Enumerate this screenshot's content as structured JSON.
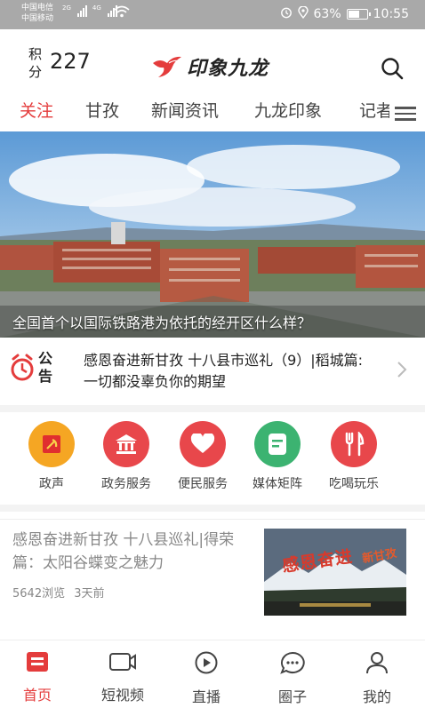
{
  "status_bar": {
    "carrier_1": "中国电信",
    "carrier_2": "中国移动",
    "net_1": "2G",
    "net_2": "4G",
    "battery_percent": "63%",
    "battery_level": 0.63,
    "time": "10:55"
  },
  "header": {
    "points_label": "积分",
    "points_value": "227",
    "brand_name": "印象九龙"
  },
  "tabs": [
    {
      "label": "关注",
      "active": true
    },
    {
      "label": "甘孜",
      "active": false
    },
    {
      "label": "新闻资讯",
      "active": false
    },
    {
      "label": "九龙印象",
      "active": false
    },
    {
      "label": "记者",
      "active": false
    }
  ],
  "banner": {
    "caption": "全国首个以国际铁路港为依托的经开区什么样？"
  },
  "notice": {
    "icon_text": "公告",
    "text": "感恩奋进新甘孜 十八县市巡礼（9）|稻城篇:一切都没辜负你的期望"
  },
  "quick_links": [
    {
      "label": "政声",
      "color": "#f5a623"
    },
    {
      "label": "政务服务",
      "color": "#e8474b"
    },
    {
      "label": "便民服务",
      "color": "#e8474b"
    },
    {
      "label": "媒体矩阵",
      "color": "#3cb371"
    },
    {
      "label": "吃喝玩乐",
      "color": "#e8474b"
    }
  ],
  "news": {
    "title": "感恩奋进新甘孜 十八县巡礼|得荣篇：太阳谷蝶变之魅力",
    "views": "5642浏览",
    "time": "3天前",
    "thumb_title": "感恩奋进",
    "thumb_side": "新甘孜"
  },
  "bottom_nav": [
    {
      "label": "首页",
      "active": true
    },
    {
      "label": "短视频",
      "active": false
    },
    {
      "label": "直播",
      "active": false
    },
    {
      "label": "圈子",
      "active": false
    },
    {
      "label": "我的",
      "active": false
    }
  ],
  "colors": {
    "accent": "#e43c3c",
    "status_bar": "#a9a9a9"
  }
}
